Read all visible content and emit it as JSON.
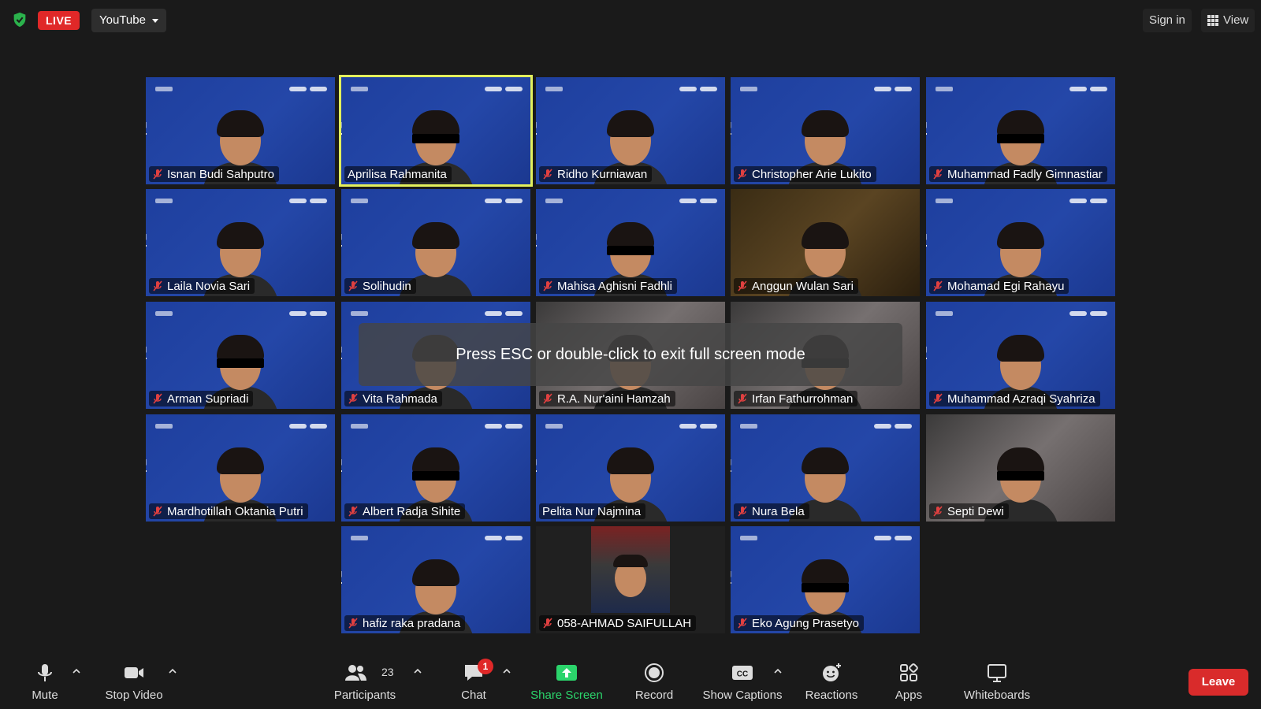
{
  "topbar": {
    "live_label": "LIVE",
    "stream_target": "YouTube",
    "sign_in": "Sign in",
    "view": "View",
    "accent_green": "#2bb24c",
    "live_color": "#e02828"
  },
  "notice": "Press ESC or double-click to exit full screen mode",
  "participants": [
    {
      "name": "Isnan Budi Sahputro",
      "muted": true,
      "active": false
    },
    {
      "name": "Aprilisa Rahmanita",
      "muted": false,
      "active": true
    },
    {
      "name": "Ridho Kurniawan",
      "muted": true,
      "active": false
    },
    {
      "name": "Christopher Arie Lukito",
      "muted": true,
      "active": false
    },
    {
      "name": "Muhammad Fadly Gimnastiar",
      "muted": true,
      "active": false
    },
    {
      "name": "Laila Novia Sari",
      "muted": true,
      "active": false
    },
    {
      "name": "Solihudin",
      "muted": true,
      "active": false
    },
    {
      "name": "Mahisa Aghisni Fadhli",
      "muted": true,
      "active": false
    },
    {
      "name": "Anggun Wulan Sari",
      "muted": true,
      "active": false
    },
    {
      "name": "Mohamad Egi Rahayu",
      "muted": true,
      "active": false
    },
    {
      "name": "Arman Supriadi",
      "muted": true,
      "active": false
    },
    {
      "name": "Vita Rahmada",
      "muted": true,
      "active": false
    },
    {
      "name": "R.A. Nur'aini Hamzah",
      "muted": true,
      "active": false
    },
    {
      "name": "Irfan Fathurrohman",
      "muted": true,
      "active": false
    },
    {
      "name": "Muhammad Azraqi Syahriza",
      "muted": true,
      "active": false
    },
    {
      "name": "Mardhotillah Oktania Putri",
      "muted": true,
      "active": false
    },
    {
      "name": "Albert Radja Sihite",
      "muted": true,
      "active": false
    },
    {
      "name": "Pelita Nur Najmina",
      "muted": false,
      "active": false
    },
    {
      "name": "Nura Bela",
      "muted": true,
      "active": false
    },
    {
      "name": "Septi Dewi",
      "muted": true,
      "active": false
    },
    {
      "name": "hafiz raka pradana",
      "muted": true,
      "active": false
    },
    {
      "name": "058-AHMAD SAIFULLAH",
      "muted": true,
      "active": false
    },
    {
      "name": "Eko Agung Prasetyo",
      "muted": true,
      "active": false
    }
  ],
  "toolbar": {
    "mute": "Mute",
    "stop_video": "Stop Video",
    "participants": "Participants",
    "participant_count": "23",
    "chat": "Chat",
    "chat_badge": "1",
    "share_screen": "Share Screen",
    "record": "Record",
    "show_captions": "Show Captions",
    "captions_icon_text": "CC",
    "reactions": "Reactions",
    "apps": "Apps",
    "whiteboards": "Whiteboards",
    "leave": "Leave",
    "share_color": "#2bd46b",
    "leave_color": "#d92b2b"
  },
  "tile_brand_text": "Edumwa"
}
